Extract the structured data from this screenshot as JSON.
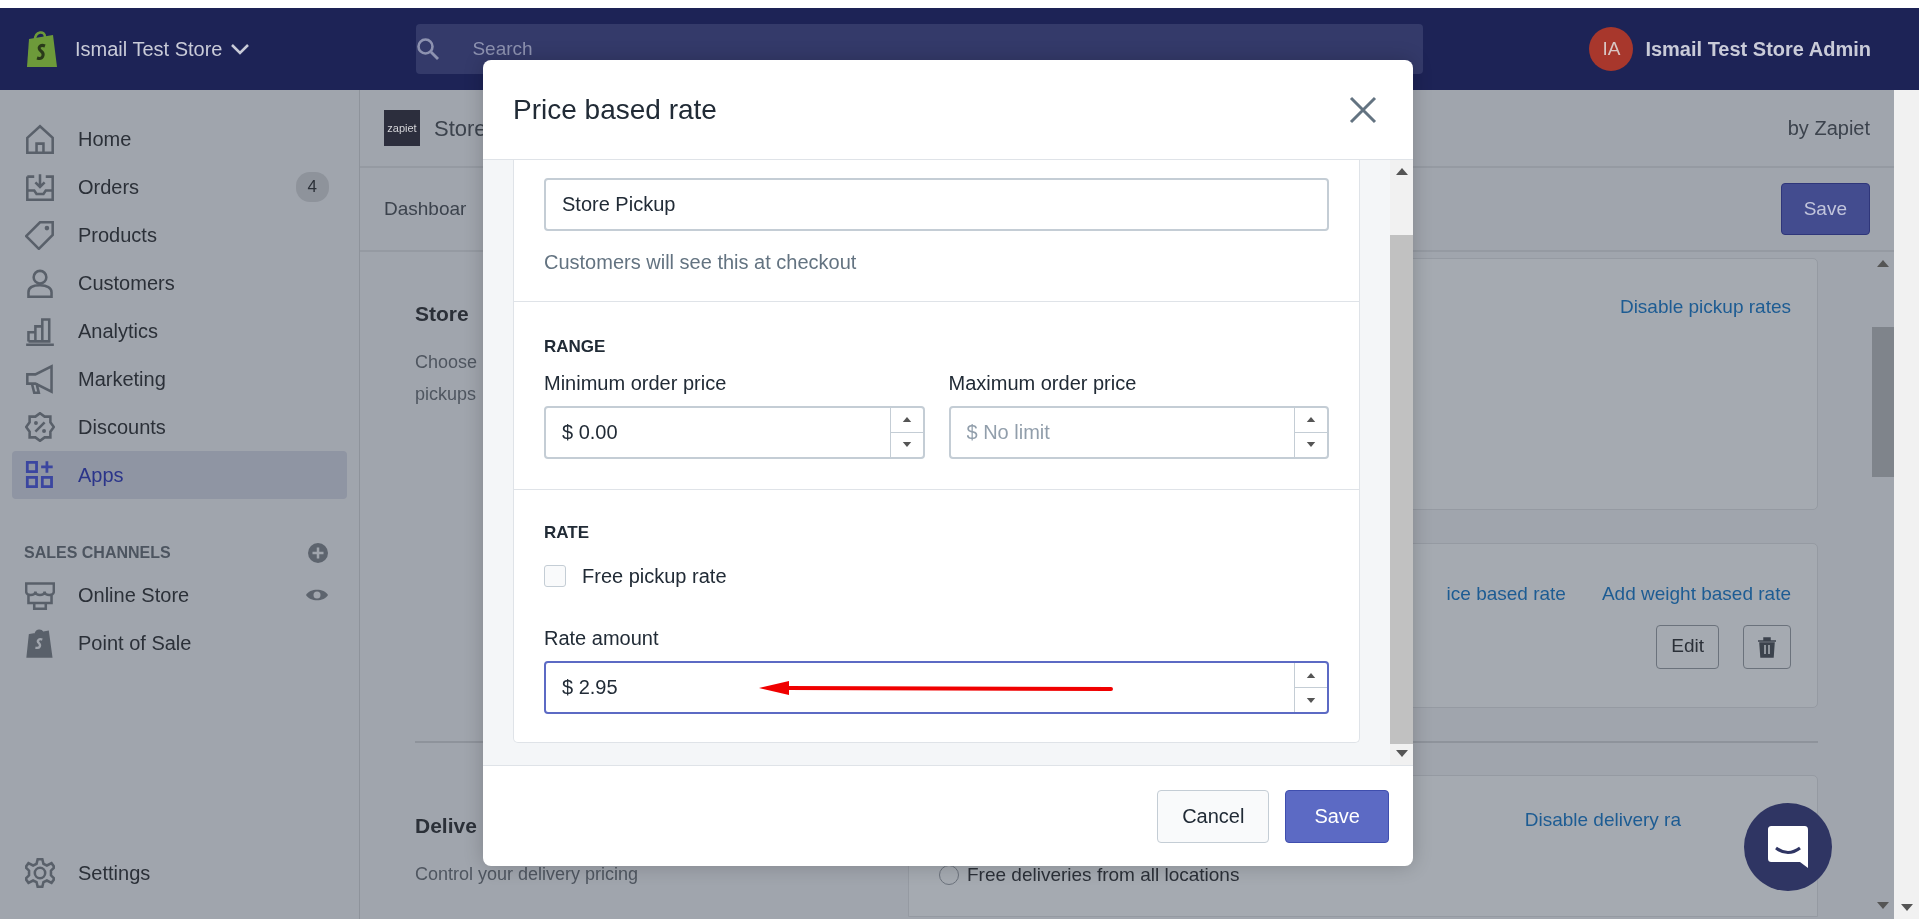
{
  "topbar": {
    "store_name": "Ismail Test Store",
    "search": {
      "placeholder": "Search"
    },
    "avatar_initials": "IA",
    "account_name": "Ismail Test Store Admin"
  },
  "sidebar": {
    "items": [
      {
        "label": "Home",
        "kind": "home",
        "selected": false
      },
      {
        "label": "Orders",
        "kind": "orders",
        "selected": false,
        "badge": "4"
      },
      {
        "label": "Products",
        "kind": "products",
        "selected": false
      },
      {
        "label": "Customers",
        "kind": "customers",
        "selected": false
      },
      {
        "label": "Analytics",
        "kind": "analytics",
        "selected": false
      },
      {
        "label": "Marketing",
        "kind": "marketing",
        "selected": false
      },
      {
        "label": "Discounts",
        "kind": "discounts",
        "selected": false
      },
      {
        "label": "Apps",
        "kind": "apps",
        "selected": true
      }
    ],
    "sales_channels": {
      "heading": "SALES CHANNELS",
      "items": [
        {
          "label": "Online Store",
          "kind": "online_store"
        },
        {
          "label": "Point of Sale",
          "kind": "point_of_sale"
        }
      ]
    },
    "settings": {
      "label": "Settings"
    }
  },
  "app_header": {
    "logo_text": "zapiet",
    "title": "Store",
    "byline": "by Zapiet"
  },
  "tab_label": "Dashboar",
  "save_button": "Save",
  "pickup_section": {
    "title": "Store",
    "description_lines": [
      "Choose",
      "pickups"
    ]
  },
  "pickup_card": {
    "link": "Disable pickup rates"
  },
  "rates_card": {
    "links": [
      "ice based rate",
      "Add weight based rate"
    ],
    "edit_button": "Edit"
  },
  "delivery_section": {
    "title": "Delive",
    "description": "Control your delivery pricing"
  },
  "delivery_card": {
    "link": "Disable delivery ra",
    "radio": {
      "label": "Free deliveries from all locations",
      "selected": false
    }
  },
  "modal": {
    "title": "Price based rate",
    "name_field": {
      "value": "Store Pickup",
      "help": "Customers will see this at checkout"
    },
    "range": {
      "heading": "RANGE",
      "min": {
        "label": "Minimum order price",
        "value": "$ 0.00"
      },
      "max": {
        "label": "Maximum order price",
        "placeholder": "$ No limit"
      }
    },
    "rate": {
      "heading": "RATE",
      "free_checkbox": {
        "label": "Free pickup rate",
        "checked": false
      },
      "amount": {
        "label": "Rate amount",
        "value": "$ 2.95",
        "focused": true
      }
    },
    "buttons": [
      {
        "label": "Cancel",
        "kind": "secondary"
      },
      {
        "label": "Save",
        "kind": "primary"
      }
    ]
  }
}
